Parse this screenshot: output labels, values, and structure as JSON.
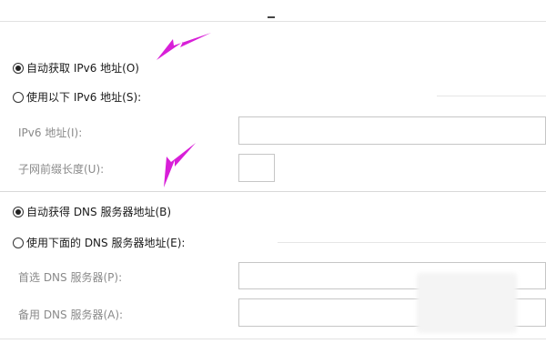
{
  "ipv6": {
    "auto_option": "自动获取 IPv6 地址(O)",
    "manual_option": "使用以下 IPv6 地址(S):",
    "address_label": "IPv6 地址(I):",
    "prefix_label": "子网前缀长度(U):",
    "address_value": "",
    "prefix_value": "",
    "auto_selected": true
  },
  "dns": {
    "auto_option": "自动获得 DNS 服务器地址(B)",
    "manual_option": "使用下面的 DNS 服务器地址(E):",
    "preferred_label": "首选 DNS 服务器(P):",
    "alternate_label": "备用 DNS 服务器(A):",
    "preferred_value": "",
    "alternate_value": "",
    "auto_selected": true
  },
  "annotation_color": "#d81fd8"
}
